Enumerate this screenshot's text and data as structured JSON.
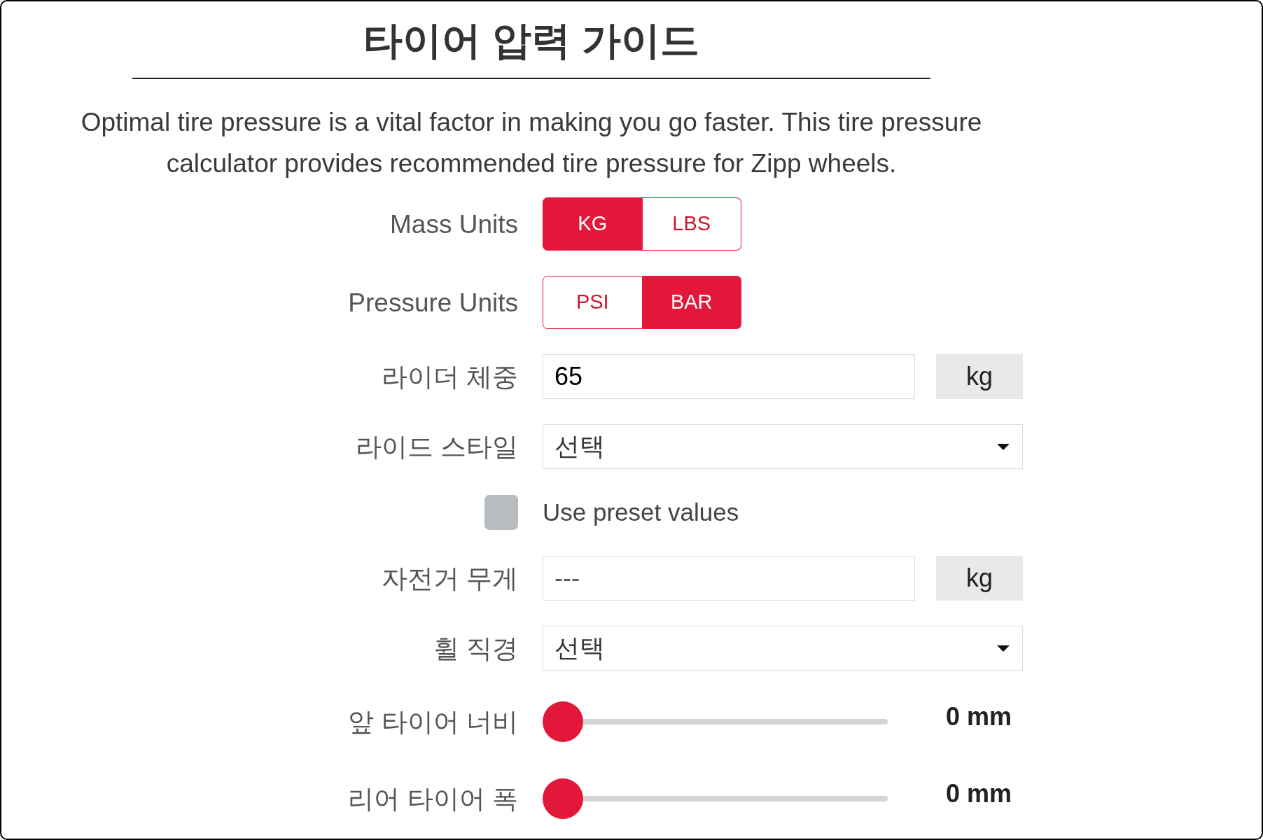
{
  "title": "타이어 압력 가이드",
  "intro": "Optimal tire pressure is a vital factor in making you go faster. This tire pressure calculator provides recommended tire pressure for Zipp wheels.",
  "form": {
    "rows": [
      {
        "kind": "toggle",
        "label": "Mass Units",
        "options": [
          {
            "label": "KG",
            "selected": true
          },
          {
            "label": "LBS",
            "selected": false
          }
        ]
      },
      {
        "kind": "toggle",
        "label": "Pressure Units",
        "options": [
          {
            "label": "PSI",
            "selected": false
          },
          {
            "label": "BAR",
            "selected": true
          }
        ]
      },
      {
        "kind": "input",
        "label": "라이더 체중",
        "value": "65",
        "unit": "kg"
      },
      {
        "kind": "select",
        "label": "라이드 스타일",
        "value": "선택"
      },
      {
        "kind": "checkbox",
        "label": "Use preset values",
        "checked": false
      },
      {
        "kind": "input",
        "label": "자전거 무게",
        "placeholder": "---",
        "unit": "kg"
      },
      {
        "kind": "select",
        "label": "휠 직경",
        "value": "선택"
      },
      {
        "kind": "slider",
        "label": "앞 타이어 너비",
        "level": 0,
        "reading": "0 mm"
      },
      {
        "kind": "slider",
        "label": "리어 타이어 폭",
        "level": 0,
        "reading": "0 mm"
      }
    ]
  }
}
